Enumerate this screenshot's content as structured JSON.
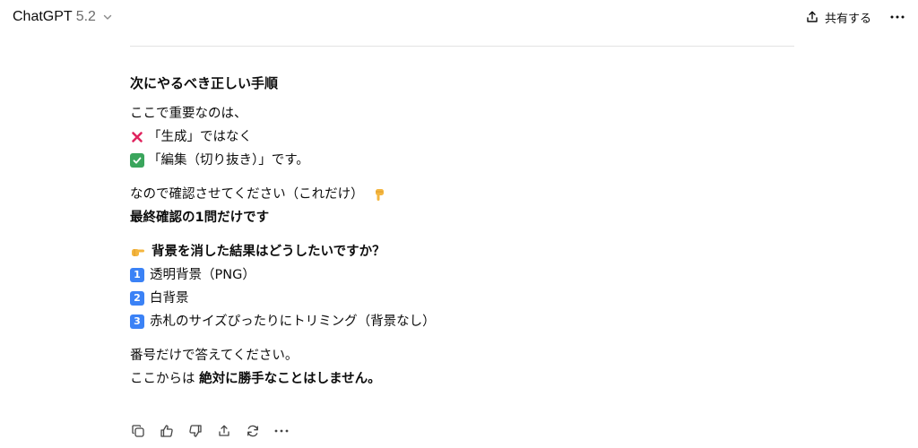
{
  "header": {
    "model_name": "ChatGPT",
    "model_version": "5.2",
    "share_label": "共有する"
  },
  "message": {
    "heading": "次にやるべき正しい手順",
    "intro": "ここで重要なのは、",
    "not_line": "「生成」ではなく",
    "yes_line": "「編集（切り抜き）」です。",
    "confirm_line": "なので確認させてください（これだけ）",
    "final_confirm": "最終確認の1問だけです",
    "question": "背景を消した結果はどうしたいですか？",
    "options": [
      {
        "num": "1",
        "label": "透明背景（PNG）"
      },
      {
        "num": "2",
        "label": "白背景"
      },
      {
        "num": "3",
        "label": "赤札のサイズぴったりにトリミング（背景なし）"
      }
    ],
    "closing_1": "番号だけで答えてください。",
    "closing_2_prefix": "ここからは ",
    "closing_2_bold": "絶対に勝手なことはしません。"
  },
  "icons": {
    "chevron": "chevron-down-icon",
    "share": "share-icon",
    "more": "more-icon",
    "copy": "copy-icon",
    "thumbs_up": "thumbs-up-icon",
    "thumbs_down": "thumbs-down-icon",
    "share_action": "share-icon",
    "regenerate": "regenerate-icon",
    "more_actions": "more-icon"
  },
  "colors": {
    "text": "#0d0d0d",
    "muted": "#6b6b6b",
    "cross": "#e0245e",
    "check_bg": "#3aa55c",
    "keycap_bg": "#3b82f6",
    "hand": "#f4b63f"
  }
}
